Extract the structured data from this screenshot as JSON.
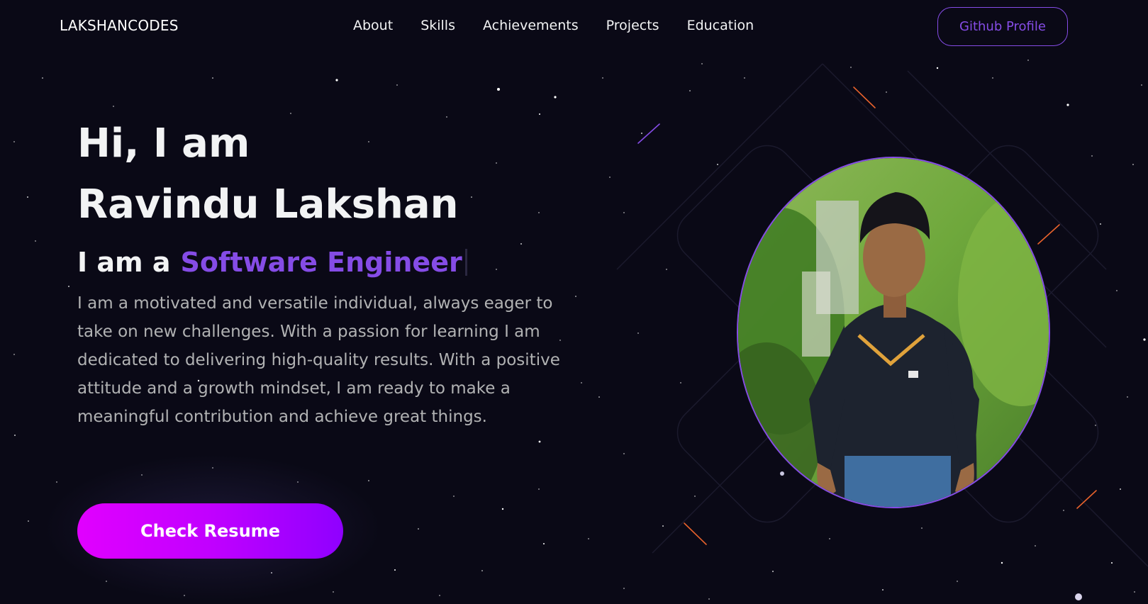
{
  "header": {
    "logo": "LAKSHANCODES",
    "nav": [
      "About",
      "Skills",
      "Achievements",
      "Projects",
      "Education"
    ],
    "github_label": "Github Profile"
  },
  "hero": {
    "greeting": "Hi, I am",
    "name": "Ravindu Lakshan",
    "role_prefix": "I am a",
    "role": "Software Engineer",
    "description": "I am a motivated and versatile individual, always eager to take on new challenges. With a passion for learning I am dedicated to delivering high-quality results. With a positive attitude and a growth mindset, I am ready to make a meaningful contribution and achieve great things.",
    "resume_label": "Check Resume"
  },
  "colors": {
    "background": "#0a0916",
    "accent": "#854ce6",
    "text_primary": "#f2f3f4",
    "text_secondary": "#b1b2b3",
    "button_gradient_start": "#e100ff",
    "button_gradient_end": "#8f00ff"
  }
}
